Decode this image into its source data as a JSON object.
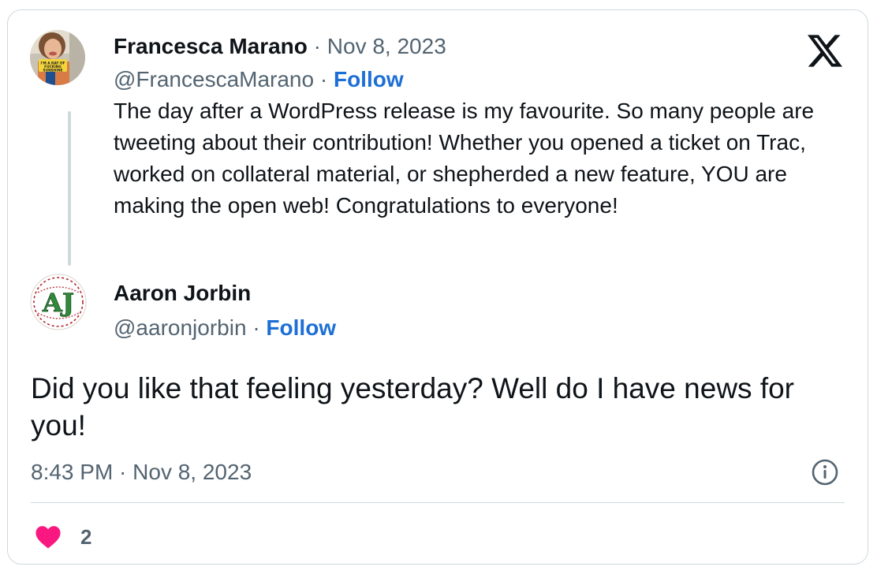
{
  "parent_tweet": {
    "author_name": "Francesca Marano",
    "date": "Nov 8, 2023",
    "handle": "@FrancescaMarano",
    "follow_label": "Follow",
    "text": "The day after a WordPress release is my favourite. So many people are tweeting about their contribution! Whether you opened a ticket on Trac, worked on collateral material, or shepherded a new feature, YOU are making the open web! Congratulations to everyone!",
    "avatar_sign_text": "I'M A RAY OF FUCKING SUNSHINE"
  },
  "reply_tweet": {
    "author_name": "Aaron Jorbin",
    "handle": "@aaronjorbin",
    "follow_label": "Follow",
    "avatar_monogram": "AJ",
    "text": "Did you like that feeling yesterday? Well do I have news for you!",
    "timestamp": "8:43 PM · Nov 8, 2023",
    "like_count": "2"
  },
  "separator": "·",
  "icons": {
    "brand": "x-logo-icon",
    "info": "info-icon",
    "like": "heart-icon"
  },
  "colors": {
    "text": "#0f1419",
    "muted": "#536471",
    "follow_link": "#1d6fd6",
    "heart": "#f91880",
    "border": "#cfd9de"
  }
}
